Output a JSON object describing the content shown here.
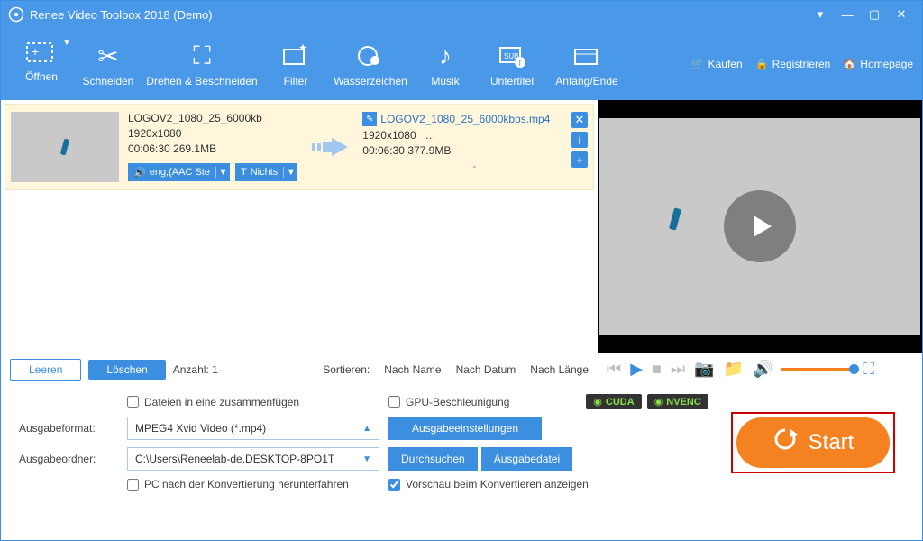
{
  "title": "Renee Video Toolbox 2018 (Demo)",
  "toolbar": {
    "open": "Öffnen",
    "cut": "Schneiden",
    "rotate": "Drehen & Beschneiden",
    "filter": "Filter",
    "watermark": "Wasserzeichen",
    "music": "Musik",
    "subtitle": "Untertitel",
    "startend": "Anfang/Ende"
  },
  "rightLinks": {
    "buy": "Kaufen",
    "register": "Registrieren",
    "homepage": "Homepage"
  },
  "file": {
    "src": {
      "name": "LOGOV2_1080_25_6000kb",
      "res": "1920x1080",
      "dur": "00:06:30",
      "size": "269.1MB"
    },
    "dst": {
      "name": "LOGOV2_1080_25_6000kbps.mp4",
      "res": "1920x1080",
      "resExtra": "…",
      "dur": "00:06:30",
      "size": "377.9MB"
    },
    "audioTag": "eng,(AAC Ste",
    "subTag": "Nichts",
    "dash": "-"
  },
  "listFooter": {
    "clear": "Leeren",
    "delete": "Löschen",
    "countLabel": "Anzahl:",
    "count": "1",
    "sortLabel": "Sortieren:",
    "byName": "Nach Name",
    "byDate": "Nach Datum",
    "byLength": "Nach Länge"
  },
  "options": {
    "merge": "Dateien in eine zusammenfügen",
    "gpu": "GPU-Beschleunigung",
    "cuda": "CUDA",
    "nvenc": "NVENC",
    "outFormatLabel": "Ausgabeformat:",
    "outFormat": "MPEG4 Xvid Video (*.mp4)",
    "outSettings": "Ausgabeeinstellungen",
    "outFolderLabel": "Ausgabeordner:",
    "outFolder": "C:\\Users\\Reneelab-de.DESKTOP-8PO1T",
    "browse": "Durchsuchen",
    "outputFile": "Ausgabedatei",
    "shutdown": "PC nach der Konvertierung herunterfahren",
    "preview": "Vorschau beim Konvertieren anzeigen"
  },
  "start": "Start"
}
